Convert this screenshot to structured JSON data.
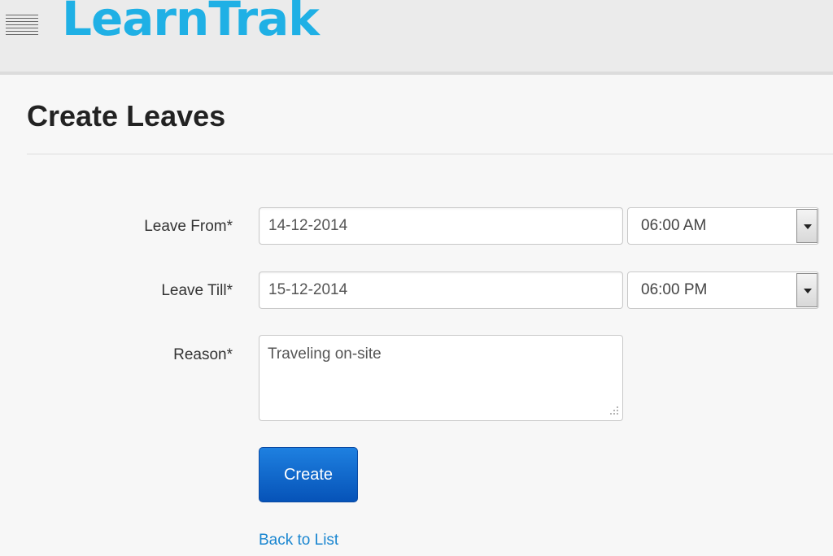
{
  "header": {
    "logo_text": "LearnTrak",
    "menu_icon": "hamburger-menu-icon",
    "brand_color": "#1fb0e5"
  },
  "page": {
    "title": "Create Leaves"
  },
  "form": {
    "leave_from": {
      "label": "Leave From*",
      "date_value": "14-12-2014",
      "time_value": "06:00 AM"
    },
    "leave_till": {
      "label": "Leave Till*",
      "date_value": "15-12-2014",
      "time_value": "06:00 PM"
    },
    "reason": {
      "label": "Reason*",
      "value": "Traveling on-site"
    },
    "create_label": "Create",
    "create_color": "#0a5fc8"
  },
  "footer": {
    "back_link": "Back to List",
    "link_color": "#1a86d0"
  }
}
